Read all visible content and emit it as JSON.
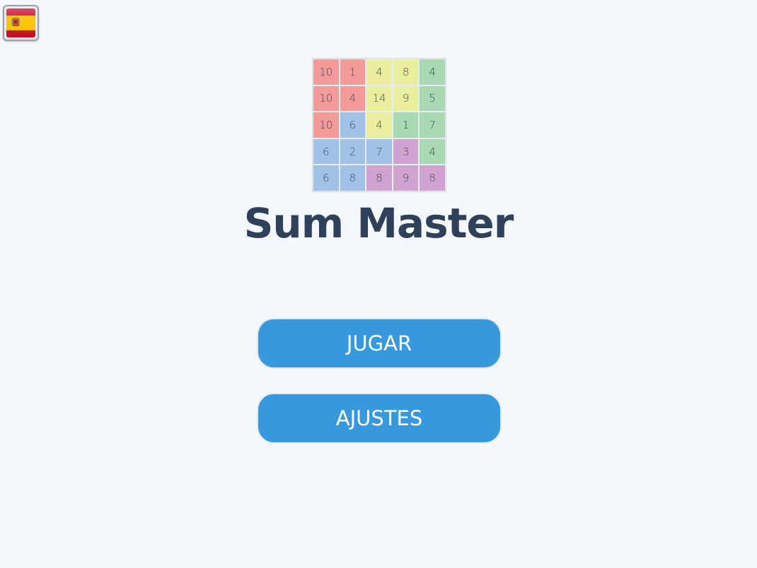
{
  "language_button": {
    "icon": "spain-flag-icon"
  },
  "logo": {
    "cells": [
      {
        "value": "10",
        "color": "#f59a9a"
      },
      {
        "value": "1",
        "color": "#f59a9a"
      },
      {
        "value": "4",
        "color": "#eaef9b"
      },
      {
        "value": "8",
        "color": "#eaef9b"
      },
      {
        "value": "4",
        "color": "#a8d9b2"
      },
      {
        "value": "10",
        "color": "#f59a9a"
      },
      {
        "value": "4",
        "color": "#f59a9a"
      },
      {
        "value": "14",
        "color": "#eaef9b"
      },
      {
        "value": "9",
        "color": "#eaef9b"
      },
      {
        "value": "5",
        "color": "#a8d9b2"
      },
      {
        "value": "10",
        "color": "#f59a9a"
      },
      {
        "value": "6",
        "color": "#a2c1e6"
      },
      {
        "value": "4",
        "color": "#eaef9b"
      },
      {
        "value": "1",
        "color": "#a8d9b2"
      },
      {
        "value": "7",
        "color": "#a8d9b2"
      },
      {
        "value": "6",
        "color": "#a2c1e6"
      },
      {
        "value": "2",
        "color": "#a2c1e6"
      },
      {
        "value": "7",
        "color": "#a2c1e6"
      },
      {
        "value": "3",
        "color": "#d0a3d1"
      },
      {
        "value": "4",
        "color": "#a8d9b2"
      },
      {
        "value": "6",
        "color": "#a2c1e6"
      },
      {
        "value": "8",
        "color": "#a2c1e6"
      },
      {
        "value": "8",
        "color": "#d0a3d1"
      },
      {
        "value": "9",
        "color": "#d0a3d1"
      },
      {
        "value": "8",
        "color": "#d0a3d1"
      }
    ]
  },
  "title": "Sum Master",
  "buttons": {
    "play_label": "JUGAR",
    "settings_label": "AJUSTES"
  },
  "colors": {
    "background": "#f4f8fc",
    "button": "#3898dc",
    "title": "#2e4159"
  }
}
